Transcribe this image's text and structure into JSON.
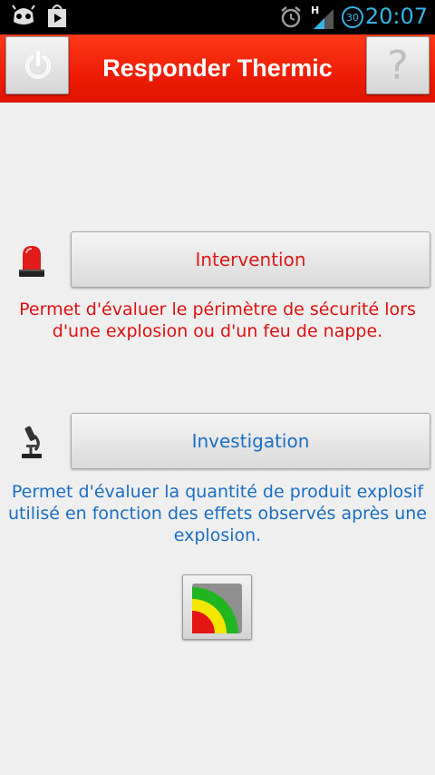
{
  "status_bar": {
    "time": "20:07",
    "signal_type": "H",
    "notification_count": "30",
    "icons": [
      "android-robot-icon",
      "play-store-icon",
      "alarm-icon",
      "signal-icon",
      "notification-badge-icon"
    ]
  },
  "action_bar": {
    "title": "Responder Thermic",
    "left_icon": "power-icon",
    "right_icon": "help-icon",
    "help_glyph": "?"
  },
  "intervention": {
    "label": "Intervention",
    "icon": "siren-icon",
    "description": "Permet d'évaluer le périmètre de sécurité lors d'une explosion ou d'un feu de nappe."
  },
  "investigation": {
    "label": "Investigation",
    "icon": "microscope-icon",
    "description": "Permet d'évaluer la quantité de produit explosif utilisé en fonction des effets observés après une explosion."
  },
  "zone_chart_button": {
    "icon": "zone-arcs-icon"
  },
  "colors": {
    "action_bar": "#ee1c06",
    "intervention_text": "#dd1a1a",
    "investigation_text": "#1c6fc4",
    "status_accent": "#33b5e5"
  }
}
